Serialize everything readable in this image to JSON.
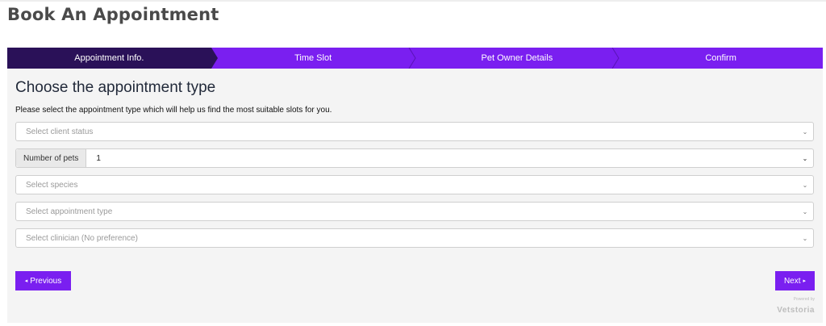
{
  "page": {
    "title": "Book An Appointment"
  },
  "stepper": {
    "steps": [
      {
        "label": "Appointment Info.",
        "active": true
      },
      {
        "label": "Time Slot",
        "active": false
      },
      {
        "label": "Pet Owner Details",
        "active": false
      },
      {
        "label": "Confirm",
        "active": false
      }
    ]
  },
  "form": {
    "heading": "Choose the appointment type",
    "description": "Please select the appointment type which will help us find the most suitable slots for you.",
    "client_status": {
      "placeholder": "Select client status"
    },
    "pets": {
      "addon_label": "Number of pets",
      "value": "1"
    },
    "species": {
      "placeholder": "Select species"
    },
    "appointment_type": {
      "placeholder": "Select appointment type"
    },
    "clinician": {
      "placeholder": "Select clinician (No preference)"
    }
  },
  "nav": {
    "previous_label": "Previous",
    "previous_icon": "◂",
    "next_label": "Next",
    "next_icon": "▸"
  },
  "branding": {
    "powered_by": "Powered by",
    "name": "Vetstoria"
  },
  "colors": {
    "accent": "#7a1ff0",
    "active_step": "#2a1158"
  },
  "icons": {
    "select_caret": "⌄"
  }
}
